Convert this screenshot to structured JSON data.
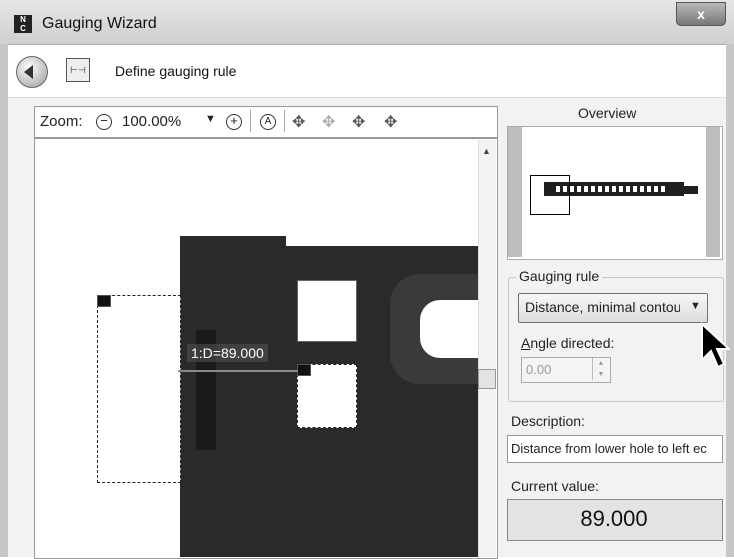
{
  "window": {
    "title": "Gauging Wizard",
    "close_label": "x",
    "app_icon": "N\nC"
  },
  "toolbar": {
    "label": "Define gauging rule",
    "back_icon": "back-arrow-icon",
    "rule_icon": "gauging-rule-icon"
  },
  "zoom": {
    "label": "Zoom:",
    "value": "100.00%",
    "out_symbol": "−",
    "in_symbol": "+",
    "fit_symbol": "A"
  },
  "image": {
    "dimension_label": "1:D=89.000"
  },
  "overview": {
    "title": "Overview"
  },
  "gauging_rule": {
    "legend": "Gauging rule",
    "selected": "Distance, minimal contou",
    "angle_label_prefix": "A",
    "angle_label_rest": "ngle directed:",
    "angle_value": "0.00"
  },
  "description": {
    "label": "Description:",
    "value": "Distance from lower hole to left ec"
  },
  "current": {
    "label": "Current value:",
    "value": "89.000"
  }
}
